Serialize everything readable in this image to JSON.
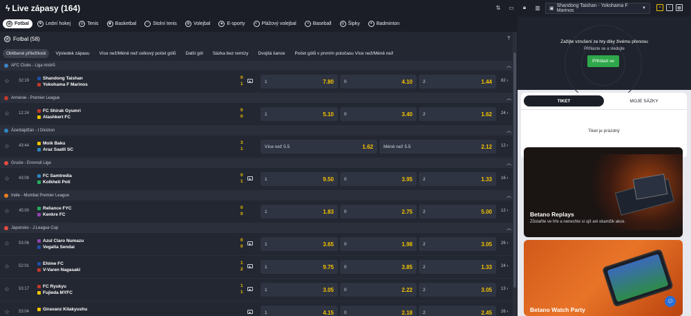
{
  "header": {
    "title": "Live zápasy (164)",
    "selected_match": "Shandong Taishan - Yokohama F Marinos"
  },
  "sports": [
    {
      "label": "Fotbal",
      "icon": "football-icon"
    },
    {
      "label": "Lední hokej",
      "icon": "hockey-icon"
    },
    {
      "label": "Tenis",
      "icon": "tennis-icon"
    },
    {
      "label": "Basketbal",
      "icon": "basketball-icon"
    },
    {
      "label": "Stolní tenis",
      "icon": "table-tennis-icon"
    },
    {
      "label": "Volejbal",
      "icon": "volleyball-icon"
    },
    {
      "label": "E-sporty",
      "icon": "esports-icon"
    },
    {
      "label": "Plážový volejbal",
      "icon": "beach-volleyball-icon"
    },
    {
      "label": "Baseball",
      "icon": "baseball-icon"
    },
    {
      "label": "Šipky",
      "icon": "darts-icon"
    },
    {
      "label": "Badminton",
      "icon": "badminton-icon"
    }
  ],
  "main": {
    "heading": "Fotbal (58)",
    "markets": [
      "Oblíbené příležitosti",
      "Výsledek zápasu",
      "Více než/Méně než celkový počet gólů",
      "Další gól",
      "Sázka bez remízy",
      "Dvojitá šance",
      "Počet gólů v prvním poločasu Více než/Méně než"
    ],
    "leagues": [
      {
        "name": "AFC Clubs - Liga mistrů",
        "flag": "#3b82c4",
        "matches": [
          {
            "time": "32:19",
            "home": "Shandong Taishan",
            "away": "Yokohama F Marinos",
            "hs": "0",
            "as": "1",
            "tv": true,
            "odds": [
              {
                "l": "1",
                "v": "7.80"
              },
              {
                "l": "0",
                "v": "4.10"
              },
              {
                "l": "2",
                "v": "1.44"
              }
            ],
            "more": "82"
          }
        ]
      },
      {
        "name": "Arménie - Premier League",
        "flag": "#c0392b",
        "matches": [
          {
            "time": "12:24",
            "home": "FC Shirak Gyumri",
            "away": "Alashkert FC",
            "hs": "0",
            "as": "0",
            "tv": false,
            "odds": [
              {
                "l": "1",
                "v": "5.10"
              },
              {
                "l": "0",
                "v": "3.40"
              },
              {
                "l": "2",
                "v": "1.62"
              }
            ],
            "more": "24"
          }
        ]
      },
      {
        "name": "Ázerbájdžán - I Divizion",
        "flag": "#2e86c1",
        "matches": [
          {
            "time": "43:44",
            "home": "Moik Baku",
            "away": "Araz Saatli SC",
            "hs": "3",
            "as": "1",
            "tv": false,
            "ou": true,
            "odds": [
              {
                "l": "Více než 5.5",
                "v": "1.62"
              },
              {
                "l": "Méně než 5.5",
                "v": "2.12"
              }
            ],
            "more": "12"
          }
        ]
      },
      {
        "name": "Gruzie - Erovnuli Liga",
        "flag": "#e74c3c",
        "matches": [
          {
            "time": "43:08",
            "home": "FC Samtredia",
            "away": "Kolkheti Poti",
            "hs": "0",
            "as": "1",
            "tv": true,
            "odds": [
              {
                "l": "1",
                "v": "9.50"
              },
              {
                "l": "0",
                "v": "3.95"
              },
              {
                "l": "2",
                "v": "1.33"
              }
            ],
            "more": "16"
          }
        ]
      },
      {
        "name": "Indie - Mumbai Premier League",
        "flag": "#e67e22",
        "matches": [
          {
            "time": "45:00",
            "home": "Reliance FYC",
            "away": "Kenkre FC",
            "hs": "0",
            "as": "0",
            "tv": false,
            "odds": [
              {
                "l": "1",
                "v": "1.83"
              },
              {
                "l": "0",
                "v": "2.75"
              },
              {
                "l": "2",
                "v": "5.00"
              }
            ],
            "more": "12"
          }
        ]
      },
      {
        "name": "Japonsko - J.League Cup",
        "flag": "#e74c3c",
        "matches": [
          {
            "time": "53:06",
            "home": "Azul Claro Numazu",
            "away": "Vegalta Sendai",
            "hs": "0",
            "as": "0",
            "tv": true,
            "odds": [
              {
                "l": "1",
                "v": "3.65"
              },
              {
                "l": "0",
                "v": "1.98"
              },
              {
                "l": "2",
                "v": "3.05"
              }
            ],
            "more": "26"
          },
          {
            "time": "52:01",
            "home": "Ehime FC",
            "away": "V-Varen Nagasaki",
            "hs": "1",
            "as": "2",
            "tv": true,
            "odds": [
              {
                "l": "1",
                "v": "9.75"
              },
              {
                "l": "0",
                "v": "3.85"
              },
              {
                "l": "2",
                "v": "1.33"
              }
            ],
            "more": "24"
          },
          {
            "time": "53:17",
            "home": "FC Ryukyu",
            "away": "Fujieda MYFC",
            "hs": "1",
            "as": "1",
            "tv": true,
            "odds": [
              {
                "l": "1",
                "v": "3.05"
              },
              {
                "l": "0",
                "v": "2.22"
              },
              {
                "l": "2",
                "v": "3.05"
              }
            ],
            "more": "13"
          },
          {
            "time": "53:04",
            "home": "Giravanz Kitakyushu",
            "away": "",
            "hs": "",
            "as": "",
            "tv": true,
            "odds": [
              {
                "l": "1",
                "v": "4.15"
              },
              {
                "l": "0",
                "v": "2.18"
              },
              {
                "l": "2",
                "v": "2.45"
              }
            ],
            "more": "26"
          }
        ]
      }
    ]
  },
  "stream": {
    "message": "Zažijte vzrušení ze hry díky živému přenosu",
    "sub": "Přihlaste se a sledujte",
    "login_label": "Přihlásit se"
  },
  "ticket": {
    "tab1": "TIKET",
    "tab2": "MOJE SÁZKY",
    "empty": "Tiket je prázdný"
  },
  "promos": {
    "replays_title": "Betano Replays",
    "replays_text": "Zůstaňte ve hře a nenechte si ujít ani okamžik akce.",
    "watch_title": "Betano Watch Party"
  },
  "colors": {
    "accent": "#f5c400",
    "login": "#2ea84a",
    "bg": "#1b1e27"
  }
}
